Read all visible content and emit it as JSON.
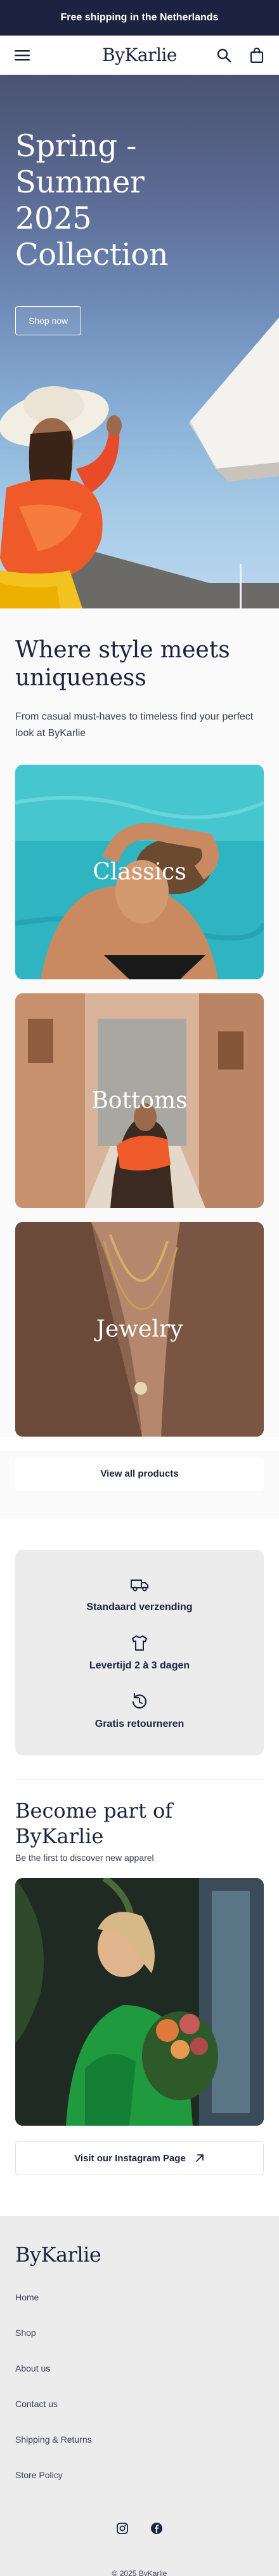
{
  "announcement": {
    "text": "Free shipping in the Netherlands"
  },
  "header": {
    "logo": "ByKarlie",
    "icons": [
      "menu-icon",
      "search-icon",
      "shopping-bag-icon"
    ]
  },
  "hero": {
    "title_lines": [
      "Spring -",
      "Summer",
      "2025",
      "Collection"
    ],
    "button_label": "Shop now"
  },
  "intro": {
    "title": "Where style meets uniqueness",
    "text": "From casual must-haves to timeless find your perfect look at ByKarlie"
  },
  "collections": [
    {
      "label": "Classics"
    },
    {
      "label": "Bottoms"
    },
    {
      "label": "Jewelry"
    }
  ],
  "view_all_label": "View all products",
  "usps": [
    {
      "icon": "truck-icon",
      "label": "Standaard verzending"
    },
    {
      "icon": "tshirt-icon",
      "label": "Levertijd 2 à 3 dagen"
    },
    {
      "icon": "return-icon",
      "label": "Gratis retourneren"
    }
  ],
  "instagram": {
    "title": "Become part of ByKarlie",
    "subtitle": "Be the first to discover new apparel",
    "button_label": "Visit our Instagram Page",
    "button_icon": "arrow-up-right-icon"
  },
  "footer": {
    "logo": "ByKarlie",
    "links": [
      "Home",
      "Shop",
      "About us",
      "Contact us",
      "Shipping & Returns",
      "Store Policy"
    ],
    "social_icons": [
      "instagram-icon",
      "facebook-icon"
    ],
    "copyright": "© 2025 ByKarlie"
  },
  "colors": {
    "navy": "#1c2340",
    "light_bg": "#fafafa",
    "gray_panel": "#ececec"
  }
}
